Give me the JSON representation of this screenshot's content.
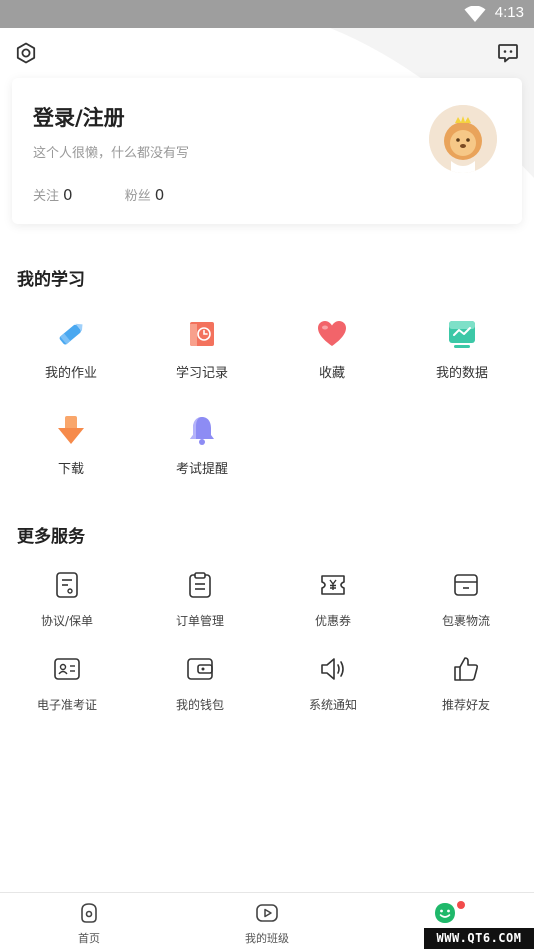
{
  "status_bar": {
    "time": "4:13"
  },
  "header": {
    "settings_icon": "gear-icon",
    "message_icon": "chat-icon"
  },
  "profile": {
    "title": "登录/注册",
    "bio": "这个人很懒，什么都没有写",
    "follow_label": "关注",
    "follow_count": "0",
    "fans_label": "粉丝",
    "fans_count": "0"
  },
  "study": {
    "title": "我的学习",
    "items": [
      {
        "label": "我的作业",
        "icon": "pencil-icon",
        "color": "#4aa8f0"
      },
      {
        "label": "学习记录",
        "icon": "clock-book-icon",
        "color": "#f3725d"
      },
      {
        "label": "收藏",
        "icon": "heart-icon",
        "color": "#f2646a"
      },
      {
        "label": "我的数据",
        "icon": "chart-icon",
        "color": "#3cc8a7"
      },
      {
        "label": "下载",
        "icon": "download-icon",
        "color": "#f68a4a"
      },
      {
        "label": "考试提醒",
        "icon": "bell-icon",
        "color": "#8d8cf4"
      }
    ]
  },
  "services": {
    "title": "更多服务",
    "items": [
      {
        "label": "协议/保单",
        "icon": "document-icon"
      },
      {
        "label": "订单管理",
        "icon": "clipboard-icon"
      },
      {
        "label": "优惠券",
        "icon": "coupon-icon"
      },
      {
        "label": "包裹物流",
        "icon": "package-icon"
      },
      {
        "label": "电子准考证",
        "icon": "id-card-icon"
      },
      {
        "label": "我的钱包",
        "icon": "wallet-icon"
      },
      {
        "label": "系统通知",
        "icon": "speaker-icon"
      },
      {
        "label": "推荐好友",
        "icon": "thumbs-up-icon"
      }
    ]
  },
  "bottom_nav": {
    "items": [
      {
        "label": "首页",
        "icon": "home-icon"
      },
      {
        "label": "我的班级",
        "icon": "class-play-icon"
      },
      {
        "label": "",
        "icon": "smile-face-icon"
      }
    ]
  },
  "watermark": "WWW.QT6.COM",
  "colors": {
    "accent_green": "#1fb86a",
    "badge_red": "#f24b4b"
  }
}
